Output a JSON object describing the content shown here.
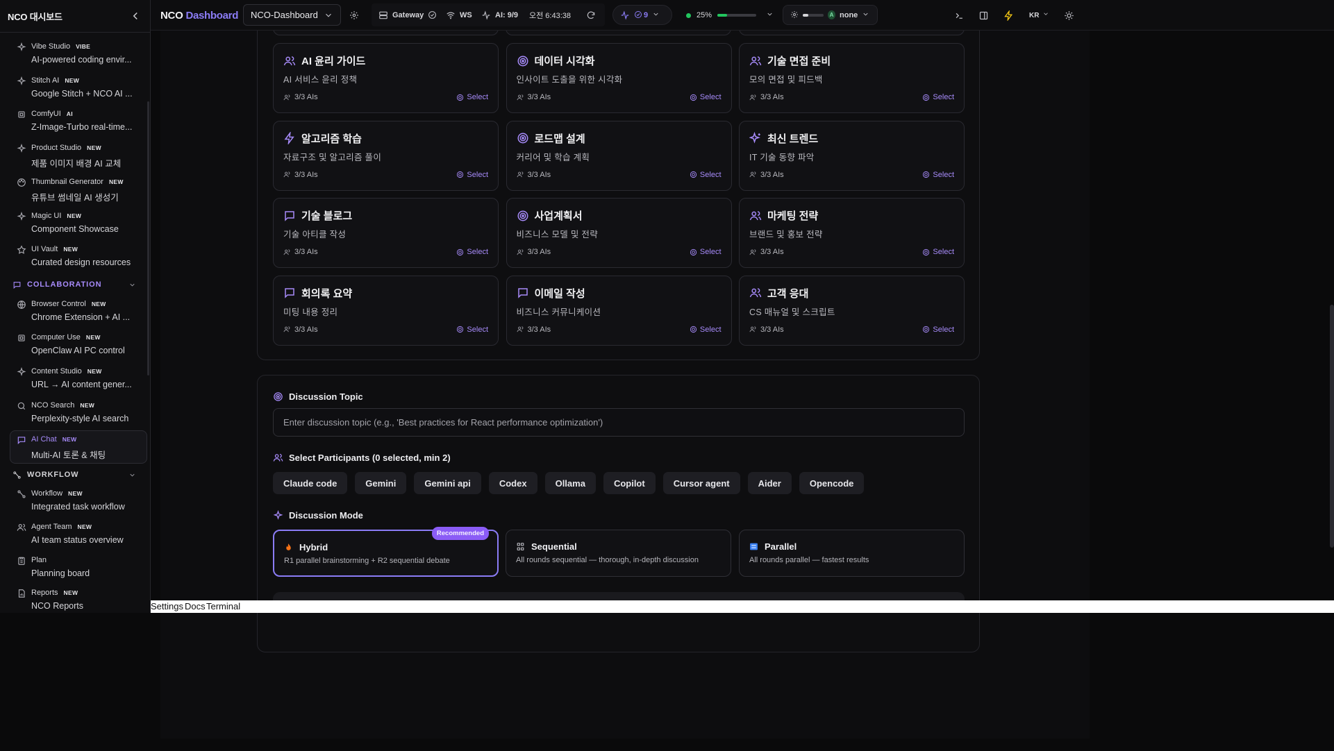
{
  "sidebar": {
    "title": "NCO 대시보드",
    "items": [
      {
        "name": "Vibe Studio",
        "badge": "VIBE",
        "desc": "AI-powered coding envir..."
      },
      {
        "name": "Stitch AI",
        "badge": "NEW",
        "desc": "Google Stitch + NCO AI ..."
      },
      {
        "name": "ComfyUI",
        "badge": "AI",
        "desc": "Z-Image-Turbo real-time..."
      },
      {
        "name": "Product Studio",
        "badge": "NEW",
        "desc": "제품 이미지 배경 AI 교체"
      },
      {
        "name": "Thumbnail Generator",
        "badge": "NEW",
        "desc": "유튜브 썸네일 AI 생성기"
      },
      {
        "name": "Magic UI",
        "badge": "NEW",
        "desc": "Component Showcase"
      },
      {
        "name": "UI Vault",
        "badge": "NEW",
        "desc": "Curated design resources"
      }
    ],
    "collab_label": "COLLABORATION",
    "collab_items": [
      {
        "name": "Browser Control",
        "badge": "NEW",
        "desc": "Chrome Extension + AI ..."
      },
      {
        "name": "Computer Use",
        "badge": "NEW",
        "desc": "OpenClaw AI PC control"
      },
      {
        "name": "Content Studio",
        "badge": "NEW",
        "desc": "URL → AI content gener..."
      },
      {
        "name": "NCO Search",
        "badge": "NEW",
        "desc": "Perplexity-style AI search"
      },
      {
        "name": "AI Chat",
        "badge": "NEW",
        "desc": "Multi-AI 토론 & 채팅"
      }
    ],
    "workflow_label": "WORKFLOW",
    "workflow_items": [
      {
        "name": "Workflow",
        "badge": "NEW",
        "desc": "Integrated task workflow"
      },
      {
        "name": "Agent Team",
        "badge": "NEW",
        "desc": "AI team status overview"
      },
      {
        "name": "Plan",
        "badge": "",
        "desc": "Planning board"
      },
      {
        "name": "Reports",
        "badge": "NEW",
        "desc": "NCO Reports"
      }
    ]
  },
  "topbar": {
    "brand_a": "NCO",
    "brand_b": "Dashboard",
    "project": "NCO-Dashboard",
    "gateway": "Gateway",
    "ws": "WS",
    "ai": "AI: 9/9",
    "time": "오전 6:43:38",
    "pill_count": "9",
    "progress_label": "25%",
    "progress_value": 0.25,
    "model": "none",
    "model_badge": "A",
    "lang": "KR"
  },
  "cards": [
    {
      "title": "AI 윤리 가이드",
      "desc": "AI 서비스 윤리 정책",
      "meta": "3/3 AIs",
      "select": "Select",
      "icon": "users-icon"
    },
    {
      "title": "데이터 시각화",
      "desc": "인사이트 도출을 위한 시각화",
      "meta": "3/3 AIs",
      "select": "Select",
      "icon": "target-icon"
    },
    {
      "title": "기술 면접 준비",
      "desc": "모의 면접 및 피드백",
      "meta": "3/3 AIs",
      "select": "Select",
      "icon": "users-icon"
    },
    {
      "title": "알고리즘 학습",
      "desc": "자료구조 및 알고리즘 풀이",
      "meta": "3/3 AIs",
      "select": "Select",
      "icon": "bolt-icon"
    },
    {
      "title": "로드맵 설계",
      "desc": "커리어 및 학습 계획",
      "meta": "3/3 AIs",
      "select": "Select",
      "icon": "target-icon"
    },
    {
      "title": "최신 트렌드",
      "desc": "IT 기술 동향 파악",
      "meta": "3/3 AIs",
      "select": "Select",
      "icon": "sparkle-icon"
    },
    {
      "title": "기술 블로그",
      "desc": "기술 아티클 작성",
      "meta": "3/3 AIs",
      "select": "Select",
      "icon": "chat-icon"
    },
    {
      "title": "사업계획서",
      "desc": "비즈니스 모델 및 전략",
      "meta": "3/3 AIs",
      "select": "Select",
      "icon": "target-icon"
    },
    {
      "title": "마케팅 전략",
      "desc": "브랜드 및 홍보 전략",
      "meta": "3/3 AIs",
      "select": "Select",
      "icon": "users-icon"
    },
    {
      "title": "회의록 요약",
      "desc": "미팅 내용 정리",
      "meta": "3/3 AIs",
      "select": "Select",
      "icon": "chat-icon"
    },
    {
      "title": "이메일 작성",
      "desc": "비즈니스 커뮤니케이션",
      "meta": "3/3 AIs",
      "select": "Select",
      "icon": "chat-icon"
    },
    {
      "title": "고객 응대",
      "desc": "CS 매뉴얼 및 스크립트",
      "meta": "3/3 AIs",
      "select": "Select",
      "icon": "users-icon"
    }
  ],
  "discussion": {
    "topic_label": "Discussion Topic",
    "topic_placeholder": "Enter discussion topic (e.g., 'Best practices for React performance optimization')",
    "participants_label": "Select Participants (0 selected, min 2)",
    "participants": [
      "Claude code",
      "Gemini",
      "Gemini api",
      "Codex",
      "Ollama",
      "Copilot",
      "Cursor agent",
      "Aider",
      "Opencode"
    ],
    "mode_label": "Discussion Mode",
    "modes": [
      {
        "title": "Hybrid",
        "desc": "R1 parallel brainstorming + R2 sequential debate",
        "badge": "Recommended"
      },
      {
        "title": "Sequential",
        "desc": "All rounds sequential — thorough, in-depth discussion"
      },
      {
        "title": "Parallel",
        "desc": "All rounds parallel — fastest results"
      }
    ]
  },
  "footer": {
    "settings": "Settings",
    "docs": "Docs",
    "terminal": "Terminal"
  },
  "colors": {
    "accent": "#8b7cf6",
    "collab": "#a78bfa",
    "success": "#22c55e",
    "warning": "#facc15"
  }
}
